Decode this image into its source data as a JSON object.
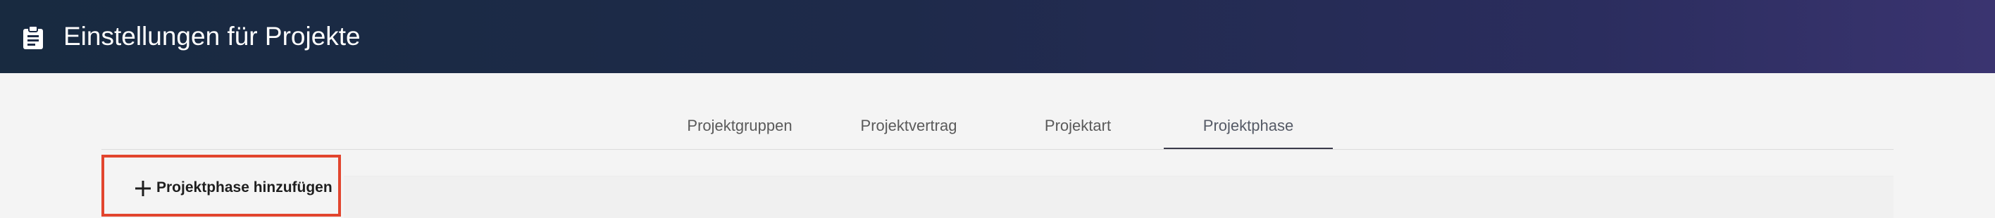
{
  "header": {
    "title": "Einstellungen für Projekte",
    "icon": "clipboard-icon",
    "gradient": [
      "#182a40",
      "#3a3470"
    ]
  },
  "tabs": [
    {
      "label": "Projektgruppen",
      "active": false
    },
    {
      "label": "Projektvertrag",
      "active": false
    },
    {
      "label": "Projektart",
      "active": false
    },
    {
      "label": "Projektphase",
      "active": true
    }
  ],
  "actions": {
    "add_label": "Projektphase hinzufügen",
    "add_icon": "plus-icon",
    "highlight_color": "#e2452e"
  }
}
